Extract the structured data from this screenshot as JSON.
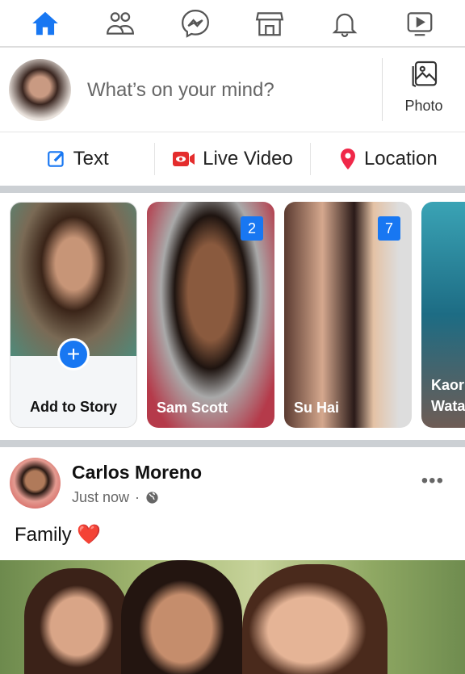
{
  "nav": {
    "tabs": [
      {
        "icon": "home-icon",
        "active": true
      },
      {
        "icon": "friends-icon"
      },
      {
        "icon": "messenger-icon"
      },
      {
        "icon": "marketplace-icon"
      },
      {
        "icon": "bell-icon"
      },
      {
        "icon": "watch-icon"
      }
    ],
    "accent": "#1877f2"
  },
  "composer": {
    "placeholder": "What’s on your mind?",
    "photo_label": "Photo"
  },
  "actions": {
    "text": "Text",
    "live": "Live Video",
    "location": "Location"
  },
  "stories": [
    {
      "name": "Add to Story"
    },
    {
      "name": "Sam Scott",
      "count": "2"
    },
    {
      "name": "Su Hai",
      "count": "7"
    },
    {
      "name": "Kaori Wata"
    }
  ],
  "post": {
    "author": "Carlos Moreno",
    "time": "Just now",
    "separator": "·",
    "privacy_icon": "globe-icon",
    "caption": "Family",
    "emoji": "❤️",
    "more": "•••"
  }
}
